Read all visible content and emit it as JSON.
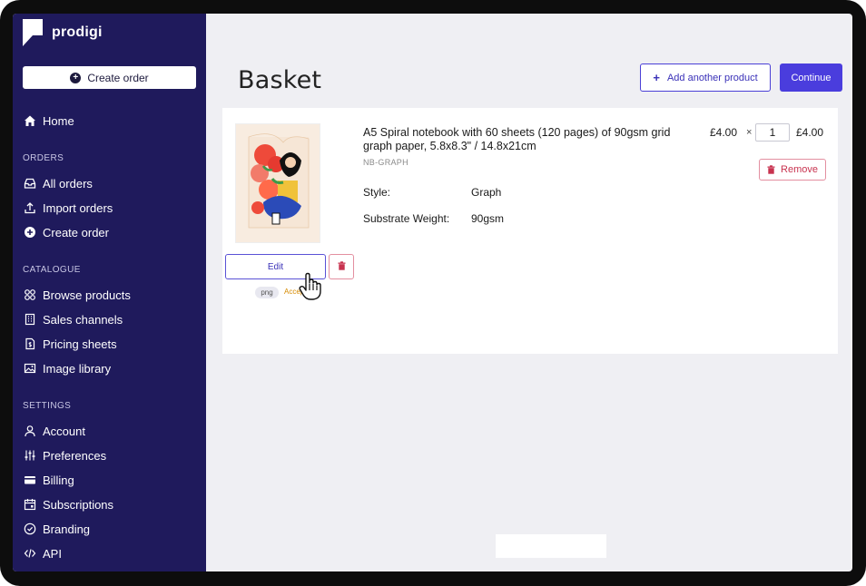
{
  "brand": {
    "name": "prodigi"
  },
  "sidebar": {
    "create_order_button": "Create order",
    "home": "Home",
    "sections": {
      "orders": "ORDERS",
      "catalogue": "CATALOGUE",
      "settings": "SETTINGS"
    },
    "orders_items": [
      "All orders",
      "Import orders",
      "Create order"
    ],
    "catalogue_items": [
      "Browse products",
      "Sales channels",
      "Pricing sheets",
      "Image library"
    ],
    "settings_items": [
      "Account",
      "Preferences",
      "Billing",
      "Subscriptions",
      "Branding",
      "API"
    ]
  },
  "header": {
    "title": "Basket",
    "add_product_label": "Add another product",
    "continue_label": "Continue"
  },
  "basket_item": {
    "title": "A5 Spiral notebook with 60 sheets (120 pages) of 90gsm grid graph paper, 5.8x8.3\" / 14.8x21cm",
    "sku": "NB-GRAPH",
    "attributes": [
      {
        "label": "Style:",
        "value": "Graph"
      },
      {
        "label": "Substrate Weight:",
        "value": "90gsm"
      }
    ],
    "unit_price": "£4.00",
    "times_symbol": "×",
    "quantity": "1",
    "total_price": "£4.00",
    "remove_label": "Remove",
    "edit_label": "Edit",
    "file_type": "png",
    "status": "Accepted"
  },
  "colors": {
    "sidebar_bg": "#1f1a5c",
    "accent": "#4a3ddd",
    "danger": "#c8334f",
    "status_accepted": "#d68a00"
  }
}
